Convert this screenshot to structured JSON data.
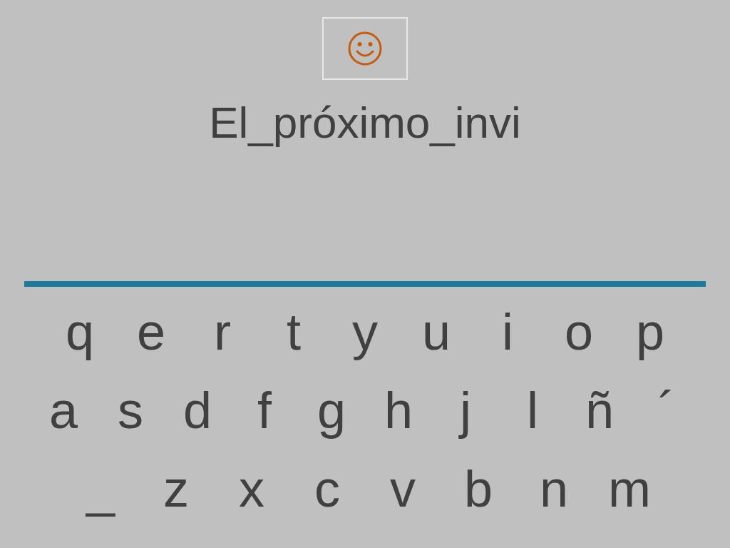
{
  "word": "El_próximo_invi",
  "keyboard": {
    "rows": [
      [
        "q",
        "e",
        "r",
        "t",
        "y",
        "u",
        "i",
        "o",
        "p"
      ],
      [
        "a",
        "s",
        "d",
        "f",
        "g",
        "h",
        "j",
        "l",
        "ñ",
        "´"
      ],
      [
        "_",
        "z",
        "x",
        "c",
        "v",
        "b",
        "n",
        "m"
      ]
    ]
  }
}
